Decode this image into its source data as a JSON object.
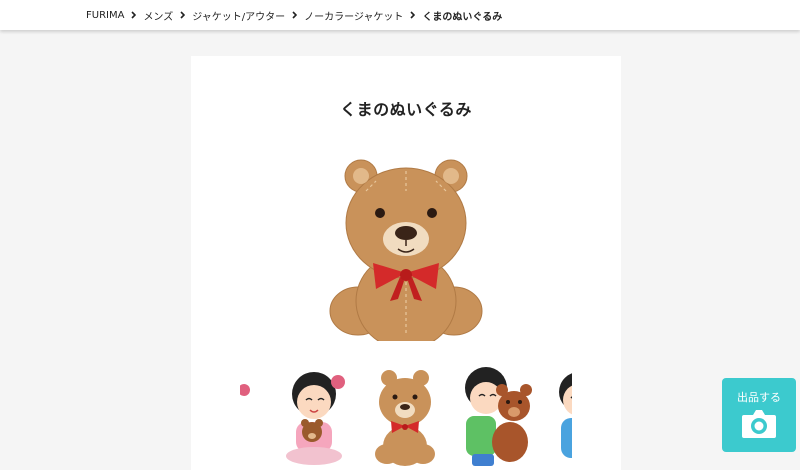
{
  "breadcrumb": {
    "items": [
      "FURIMA",
      "メンズ",
      "ジャケット/アウター",
      "ノーカラージャケット"
    ],
    "current": "くまのぬいぐるみ"
  },
  "item": {
    "title": "くまのぬいぐるみ",
    "main_image": "teddy-bear",
    "thumbnails": [
      "girl-pink-partial",
      "girl-hugging-bear",
      "teddy-bear",
      "girl-hugging-big-bear",
      "child-blue-partial"
    ]
  },
  "sell_button": {
    "label": "出品する",
    "icon": "camera-icon"
  },
  "colors": {
    "accent": "#3ccace",
    "bear": "#c9925a",
    "ribbon": "#d42a2a"
  }
}
